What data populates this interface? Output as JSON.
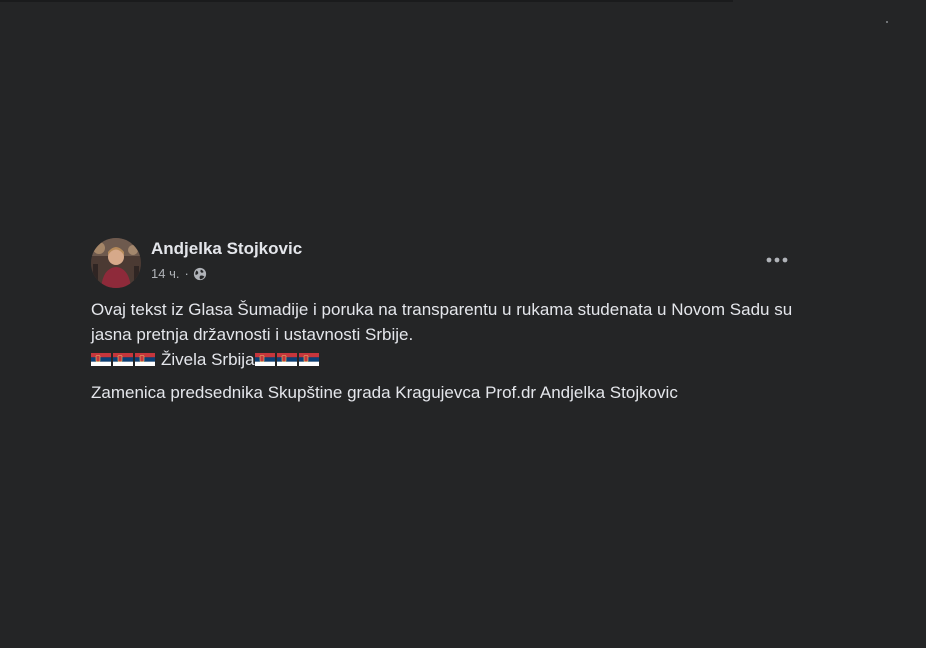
{
  "post": {
    "author": "Andjelka Stojkovic",
    "time": "14 ч.",
    "separator": "·",
    "privacy_icon": "globe-icon",
    "more_icon": "more-options-icon",
    "text_line_1": "Ovaj tekst iz Glasa Šumadije i poruka na transparentu u rukama studenata u Novom Sadu su jasna pretnja državnosti i ustavnosti Srbije.",
    "text_line_2": "Živela Srbija",
    "flag_icon": "serbia-flag-icon",
    "signature": "Zamenica predsednika Skupštine grada Kragujevca Prof.dr Andjelka Stojkovic"
  },
  "colors": {
    "background": "#242526",
    "primary_text": "#e4e6eb",
    "secondary_text": "#b0b3b8",
    "flag_red": "#c6363c",
    "flag_blue": "#0c4076",
    "flag_white": "#ffffff"
  }
}
